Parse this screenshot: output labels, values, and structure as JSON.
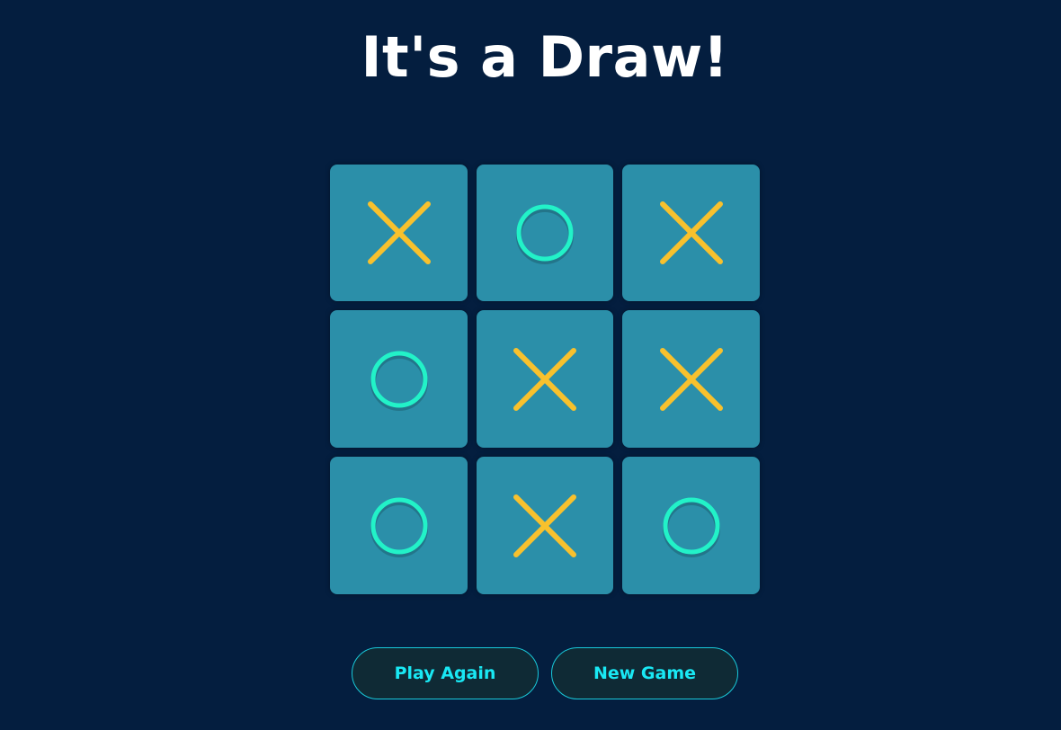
{
  "status": {
    "title": "It's a Draw!"
  },
  "board": {
    "cells": [
      "X",
      "O",
      "X",
      "O",
      "X",
      "X",
      "O",
      "X",
      "O"
    ]
  },
  "buttons": {
    "play_again": "Play Again",
    "new_game": "New Game"
  },
  "colors": {
    "background": "#041e3f",
    "cell": "#2b8fa9",
    "x_mark": "#f8c12d",
    "o_mark": "#22f2c8",
    "button_text": "#19e8f4",
    "button_border": "#19c9d9"
  },
  "icons": {
    "X": "x-mark-icon",
    "O": "o-mark-icon"
  }
}
